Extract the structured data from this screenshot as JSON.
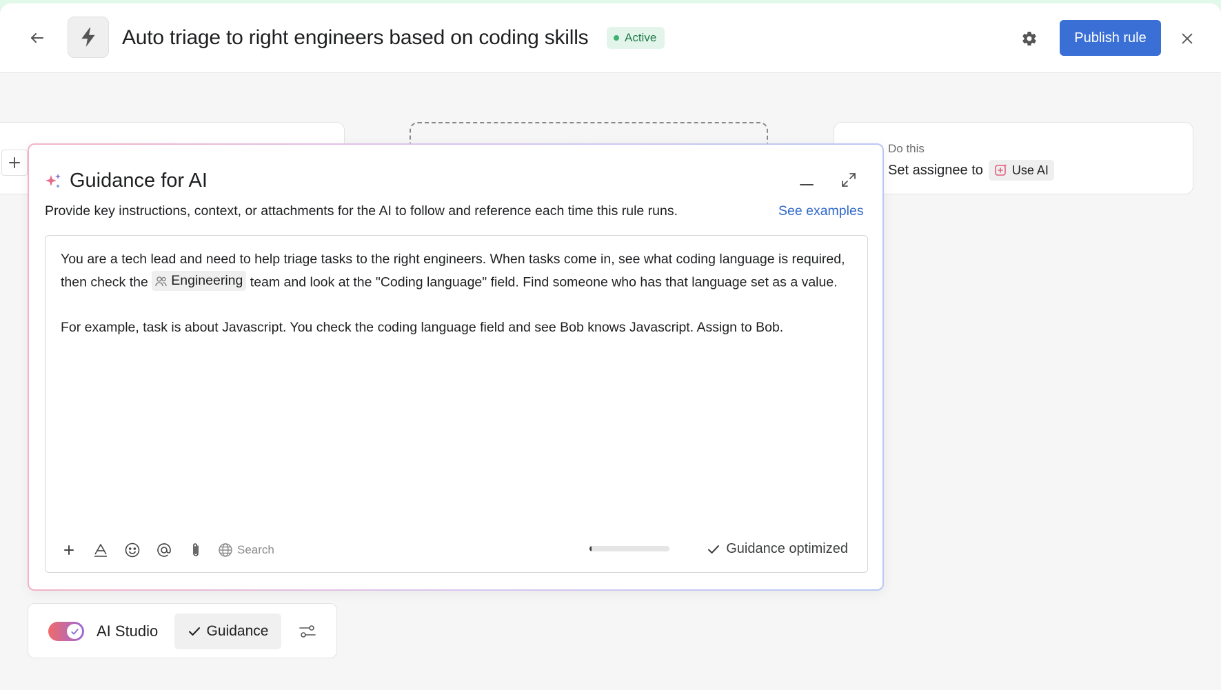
{
  "header": {
    "back_icon": "arrow-left-icon",
    "rule_icon": "lightning-bolt-icon",
    "title": "Auto triage to right engineers based on coding skills",
    "status": "Active",
    "settings_icon": "gear-icon",
    "publish_label": "Publish rule",
    "close_icon": "close-icon"
  },
  "canvas": {
    "action_card": {
      "label": "Do this",
      "action_text": "Set assignee to",
      "chip_label": "Use AI"
    }
  },
  "guidance_panel": {
    "title": "Guidance for AI",
    "description": "Provide key instructions, context, or attachments for the AI to follow and reference each time this rule runs.",
    "see_examples": "See examples",
    "paragraph_1_before": "You are a tech lead and need to help triage tasks to the right engineers. When tasks come in, see what coding language is required, then check the",
    "team_chip": "Engineering",
    "paragraph_1_after": "team and look at the \"Coding language\" field. Find someone who has that language set as a value.",
    "paragraph_2": "For example, task is about Javascript. You check the coding language field and see Bob knows Javascript. Assign to Bob.",
    "toolbar": {
      "search_label": "Search"
    },
    "progress_fraction": 0.03,
    "optimized_label": "Guidance optimized"
  },
  "studio_bar": {
    "toggle_on": true,
    "label": "AI Studio",
    "guidance_label": "Guidance"
  },
  "colors": {
    "accent": "#3a6fd6",
    "active_green": "#237a4b",
    "link": "#2f68c9"
  }
}
